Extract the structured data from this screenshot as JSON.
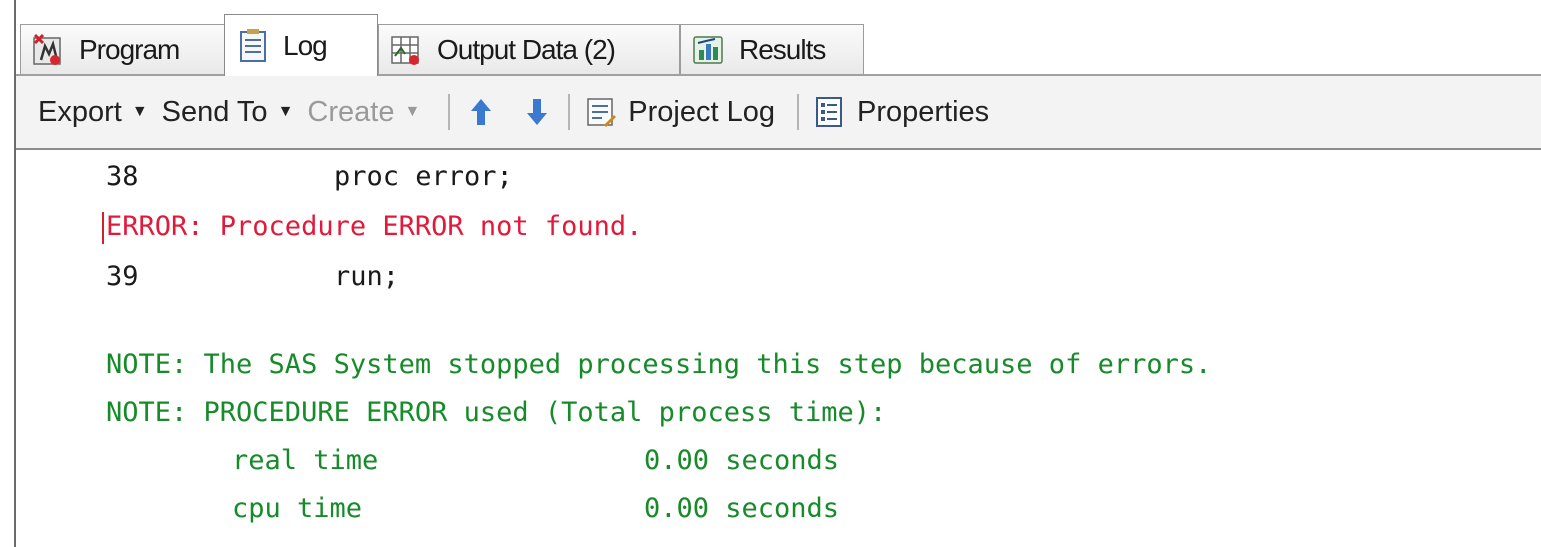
{
  "tabs": [
    {
      "label": "Program",
      "icon": "program-icon",
      "active": false
    },
    {
      "label": "Log",
      "icon": "log-icon",
      "active": true
    },
    {
      "label": "Output Data (2)",
      "icon": "output-data-icon",
      "active": false
    },
    {
      "label": "Results",
      "icon": "results-icon",
      "active": false
    }
  ],
  "toolbar": {
    "export_label": "Export",
    "send_to_label": "Send To",
    "create_label": "Create",
    "project_log_label": "Project Log",
    "properties_label": "Properties"
  },
  "log": {
    "line1_num": "38",
    "line1_code": "proc error;",
    "error_text": "ERROR: Procedure ERROR not found.",
    "line2_num": "39",
    "line2_code": "run;",
    "note1": "NOTE: The SAS System stopped processing this step because of errors.",
    "note2": "NOTE: PROCEDURE ERROR used (Total process time):",
    "real_time_label": "real time",
    "real_time_value": "0.00 seconds",
    "cpu_time_label": "cpu time",
    "cpu_time_value": "0.00 seconds"
  },
  "colors": {
    "error": "#e01a3a",
    "note": "#178a2a",
    "source": "#1a1a1a"
  }
}
